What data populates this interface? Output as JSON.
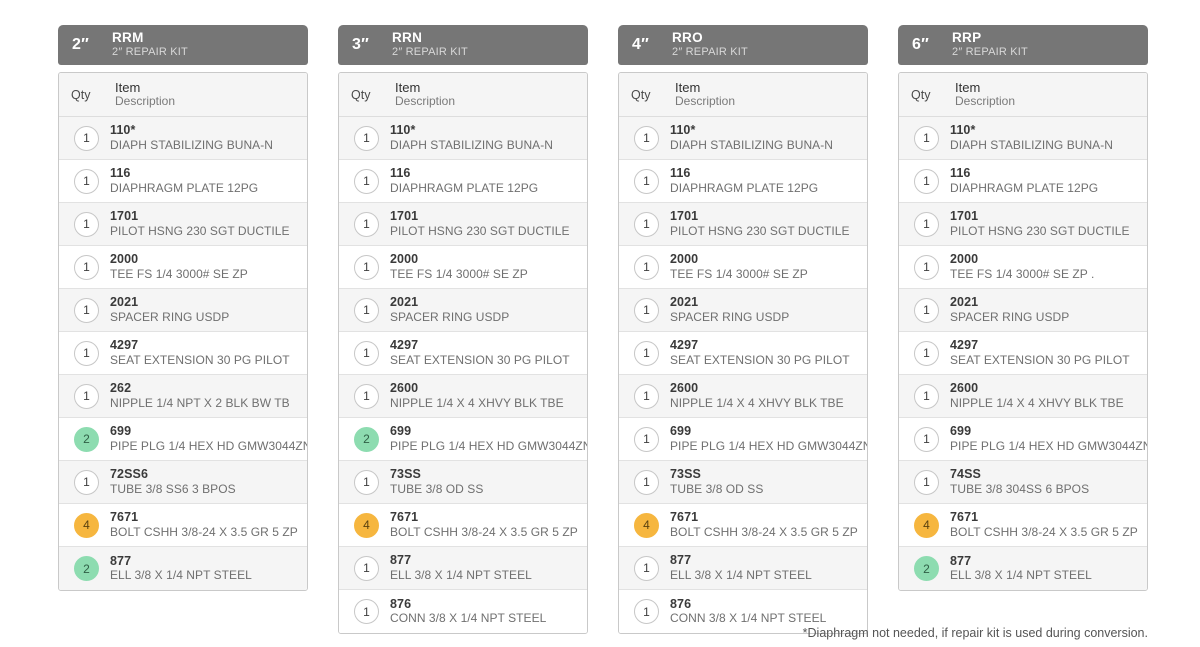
{
  "footnote": "*Diaphragm not needed, if repair kit is used during conversion.",
  "colors": {
    "header_bar": "#767676",
    "badge_green": "#8ddcb0",
    "badge_orange": "#f6b63f",
    "badge_default": "#ffffff"
  },
  "column_headers": {
    "qty": "Qty",
    "item": "Item",
    "description": "Description"
  },
  "kits": [
    {
      "size": "2″",
      "code": "RRM",
      "subtitle": "2″ REPAIR KIT",
      "rows": [
        {
          "qty": "1",
          "badge": "default",
          "item": "110*",
          "desc": "DIAPH STABILIZING BUNA-N"
        },
        {
          "qty": "1",
          "badge": "default",
          "item": "116",
          "desc": "DIAPHRAGM PLATE 12PG"
        },
        {
          "qty": "1",
          "badge": "default",
          "item": "1701",
          "desc": "PILOT HSNG 230 SGT DUCTILE"
        },
        {
          "qty": "1",
          "badge": "default",
          "item": "2000",
          "desc": "TEE FS 1/4 3000# SE ZP"
        },
        {
          "qty": "1",
          "badge": "default",
          "item": "2021",
          "desc": "SPACER RING USDP"
        },
        {
          "qty": "1",
          "badge": "default",
          "item": "4297",
          "desc": "SEAT EXTENSION 30 PG PILOT"
        },
        {
          "qty": "1",
          "badge": "default",
          "item": "262",
          "desc": "NIPPLE 1/4 NPT X 2 BLK BW TB"
        },
        {
          "qty": "2",
          "badge": "green",
          "item": "699",
          "desc": "PIPE PLG 1/4 HEX HD GMW3044ZN"
        },
        {
          "qty": "1",
          "badge": "default",
          "item": "72SS6",
          "desc": "TUBE 3/8 SS6 3 BPOS"
        },
        {
          "qty": "4",
          "badge": "orange",
          "item": "7671",
          "desc": "BOLT CSHH 3/8-24 X 3.5 GR 5 ZP"
        },
        {
          "qty": "2",
          "badge": "green",
          "item": "877",
          "desc": "ELL 3/8 X 1/4 NPT STEEL"
        }
      ]
    },
    {
      "size": "3″",
      "code": "RRN",
      "subtitle": "2″ REPAIR KIT",
      "rows": [
        {
          "qty": "1",
          "badge": "default",
          "item": "110*",
          "desc": "DIAPH STABILIZING BUNA-N"
        },
        {
          "qty": "1",
          "badge": "default",
          "item": "116",
          "desc": "DIAPHRAGM PLATE 12PG"
        },
        {
          "qty": "1",
          "badge": "default",
          "item": "1701",
          "desc": "PILOT HSNG 230 SGT DUCTILE"
        },
        {
          "qty": "1",
          "badge": "default",
          "item": "2000",
          "desc": "TEE FS 1/4 3000# SE ZP"
        },
        {
          "qty": "1",
          "badge": "default",
          "item": "2021",
          "desc": "SPACER RING USDP"
        },
        {
          "qty": "1",
          "badge": "default",
          "item": "4297",
          "desc": "SEAT EXTENSION 30 PG PILOT"
        },
        {
          "qty": "1",
          "badge": "default",
          "item": "2600",
          "desc": "NIPPLE 1/4 X 4 XHVY BLK TBE"
        },
        {
          "qty": "2",
          "badge": "green",
          "item": "699",
          "desc": "PIPE PLG 1/4 HEX HD GMW3044ZN"
        },
        {
          "qty": "1",
          "badge": "default",
          "item": "73SS",
          "desc": "TUBE 3/8 OD SS"
        },
        {
          "qty": "4",
          "badge": "orange",
          "item": "7671",
          "desc": "BOLT CSHH 3/8-24 X 3.5 GR 5 ZP"
        },
        {
          "qty": "1",
          "badge": "default",
          "item": "877",
          "desc": "ELL 3/8 X 1/4 NPT STEEL"
        },
        {
          "qty": "1",
          "badge": "default",
          "item": "876",
          "desc": "CONN 3/8 X 1/4 NPT STEEL"
        }
      ]
    },
    {
      "size": "4″",
      "code": "RRO",
      "subtitle": "2″ REPAIR KIT",
      "rows": [
        {
          "qty": "1",
          "badge": "default",
          "item": "110*",
          "desc": "DIAPH STABILIZING BUNA-N"
        },
        {
          "qty": "1",
          "badge": "default",
          "item": "116",
          "desc": "DIAPHRAGM PLATE 12PG"
        },
        {
          "qty": "1",
          "badge": "default",
          "item": "1701",
          "desc": "PILOT HSNG 230 SGT DUCTILE"
        },
        {
          "qty": "1",
          "badge": "default",
          "item": "2000",
          "desc": "TEE FS 1/4 3000# SE ZP"
        },
        {
          "qty": "1",
          "badge": "default",
          "item": "2021",
          "desc": "SPACER RING USDP"
        },
        {
          "qty": "1",
          "badge": "default",
          "item": "4297",
          "desc": "SEAT EXTENSION 30 PG PILOT"
        },
        {
          "qty": "1",
          "badge": "default",
          "item": "2600",
          "desc": "NIPPLE 1/4 X 4 XHVY BLK TBE"
        },
        {
          "qty": "1",
          "badge": "default",
          "item": "699",
          "desc": "PIPE PLG 1/4 HEX HD GMW3044ZN"
        },
        {
          "qty": "1",
          "badge": "default",
          "item": "73SS",
          "desc": "TUBE 3/8 OD SS"
        },
        {
          "qty": "4",
          "badge": "orange",
          "item": "7671",
          "desc": "BOLT CSHH 3/8-24 X 3.5 GR 5 ZP"
        },
        {
          "qty": "1",
          "badge": "default",
          "item": "877",
          "desc": "ELL 3/8 X 1/4 NPT STEEL"
        },
        {
          "qty": "1",
          "badge": "default",
          "item": "876",
          "desc": "CONN 3/8 X 1/4 NPT STEEL"
        }
      ]
    },
    {
      "size": "6″",
      "code": "RRP",
      "subtitle": "2″ REPAIR KIT",
      "rows": [
        {
          "qty": "1",
          "badge": "default",
          "item": "110*",
          "desc": "DIAPH STABILIZING BUNA-N"
        },
        {
          "qty": "1",
          "badge": "default",
          "item": "116",
          "desc": "DIAPHRAGM PLATE 12PG"
        },
        {
          "qty": "1",
          "badge": "default",
          "item": "1701",
          "desc": "PILOT HSNG 230 SGT DUCTILE"
        },
        {
          "qty": "1",
          "badge": "default",
          "item": "2000",
          "desc": "TEE FS 1/4 3000# SE ZP ."
        },
        {
          "qty": "1",
          "badge": "default",
          "item": "2021",
          "desc": "SPACER RING USDP"
        },
        {
          "qty": "1",
          "badge": "default",
          "item": "4297",
          "desc": "SEAT EXTENSION 30 PG PILOT"
        },
        {
          "qty": "1",
          "badge": "default",
          "item": "2600",
          "desc": "NIPPLE 1/4 X 4 XHVY BLK TBE"
        },
        {
          "qty": "1",
          "badge": "default",
          "item": "699",
          "desc": "PIPE PLG 1/4 HEX HD GMW3044ZN"
        },
        {
          "qty": "1",
          "badge": "default",
          "item": "74SS",
          "desc": "TUBE 3/8 304SS 6 BPOS"
        },
        {
          "qty": "4",
          "badge": "orange",
          "item": "7671",
          "desc": "BOLT CSHH 3/8-24 X 3.5 GR 5 ZP"
        },
        {
          "qty": "2",
          "badge": "green",
          "item": "877",
          "desc": "ELL 3/8 X 1/4 NPT STEEL"
        }
      ]
    }
  ]
}
